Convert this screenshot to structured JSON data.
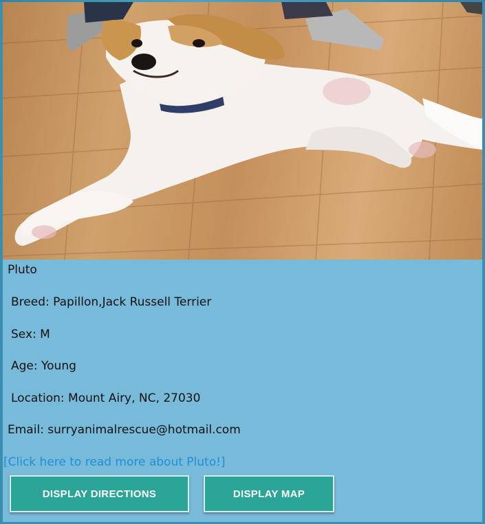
{
  "pet": {
    "name": "Pluto",
    "breed": "Breed: Papillon,Jack Russell Terrier",
    "sex": "Sex: M",
    "age": "Age: Young",
    "location": "Location: Mount Airy, NC, 27030",
    "email": "Email: surryanimalrescue@hotmail.com",
    "more_link": "[Click here to read more about Pluto!]"
  },
  "actions": {
    "directions_label": "DISPLAY DIRECTIONS",
    "map_label": "DISPLAY MAP"
  },
  "colors": {
    "panel_bg": "#78bad9",
    "button_bg": "#2aa597",
    "link": "#1f8fd8"
  }
}
